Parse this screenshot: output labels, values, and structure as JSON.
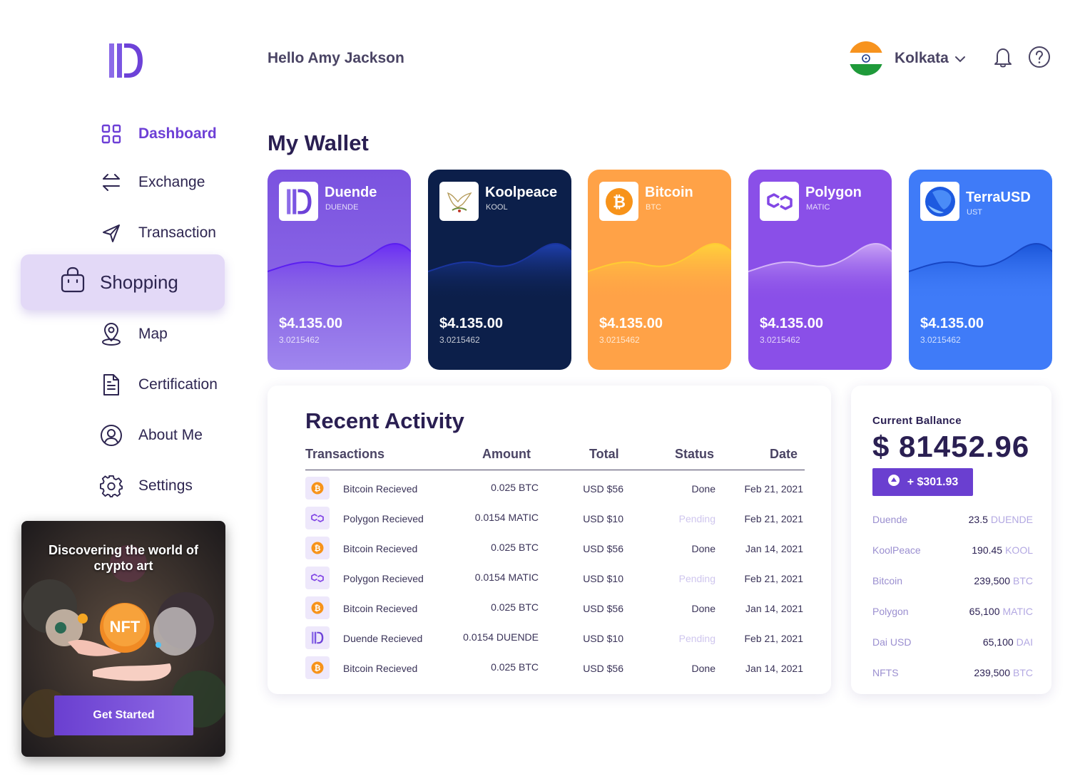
{
  "header": {
    "greeting": "Hello Amy Jackson",
    "location": "Kolkata",
    "icons": [
      "india-flag-icon",
      "chevron-down-icon",
      "bell-icon",
      "help-icon"
    ]
  },
  "sidebar": {
    "items": [
      {
        "label": "Dashboard",
        "icon": "dashboard-icon",
        "active": true
      },
      {
        "label": "Exchange",
        "icon": "exchange-icon"
      },
      {
        "label": "Transaction",
        "icon": "send-icon"
      },
      {
        "label": "Shopping",
        "icon": "shopping-bag-icon",
        "highlighted": true
      },
      {
        "label": "Map",
        "icon": "map-pin-icon"
      },
      {
        "label": "Certification",
        "icon": "document-icon"
      },
      {
        "label": "About Me",
        "icon": "user-icon"
      },
      {
        "label": "Settings",
        "icon": "gear-icon"
      }
    ],
    "promo": {
      "title": "Discovering the  world of crypto art",
      "badge": "NFT",
      "button": "Get Started"
    }
  },
  "wallet": {
    "title": "My Wallet",
    "cards": [
      {
        "name": "Duende",
        "symbol": "DUENDE",
        "amount": "$4.135.00",
        "sub": "3.0215462",
        "color": "#7b56e0"
      },
      {
        "name": "Koolpeace",
        "symbol": "KOOL",
        "amount": "$4.135.00",
        "sub": "3.0215462",
        "color": "#0c1f4a"
      },
      {
        "name": "Bitcoin",
        "symbol": "BTC",
        "amount": "$4.135.00",
        "sub": "3.0215462",
        "color": "#ffa247"
      },
      {
        "name": "Polygon",
        "symbol": "MATIC",
        "amount": "$4.135.00",
        "sub": "3.0215462",
        "color": "#8a4fe8"
      },
      {
        "name": "TerraUSD",
        "symbol": "UST",
        "amount": "$4.135.00",
        "sub": "3.0215462",
        "color": "#3f7bf8"
      }
    ]
  },
  "activity": {
    "title": "Recent Activity",
    "columns": [
      "Transactions",
      "Amount",
      "Total",
      "Status",
      "Date"
    ],
    "rows": [
      {
        "icon": "bitcoin-icon",
        "tx": "Bitcoin Recieved",
        "amount": "0.025 BTC",
        "total": "USD $56",
        "status": "Done",
        "date": "Feb 21, 2021"
      },
      {
        "icon": "polygon-icon",
        "tx": "Polygon Recieved",
        "amount": "0.0154 MATIC",
        "total": "USD $10",
        "status": "Pending",
        "date": "Feb 21, 2021"
      },
      {
        "icon": "bitcoin-icon",
        "tx": "Bitcoin Recieved",
        "amount": "0.025 BTC",
        "total": "USD $56",
        "status": "Done",
        "date": "Jan 14, 2021"
      },
      {
        "icon": "polygon-icon",
        "tx": "Polygon Recieved",
        "amount": "0.0154 MATIC",
        "total": "USD $10",
        "status": "Pending",
        "date": "Feb 21, 2021"
      },
      {
        "icon": "bitcoin-icon",
        "tx": "Bitcoin Recieved",
        "amount": "0.025 BTC",
        "total": "USD $56",
        "status": "Done",
        "date": "Jan 14, 2021"
      },
      {
        "icon": "duende-icon",
        "tx": "Duende Recieved",
        "amount": "0.0154 DUENDE",
        "total": "USD $10",
        "status": "Pending",
        "date": "Feb 21, 2021"
      },
      {
        "icon": "bitcoin-icon",
        "tx": "Bitcoin Recieved",
        "amount": "0.025 BTC",
        "total": "USD $56",
        "status": "Done",
        "date": "Jan 14, 2021"
      }
    ]
  },
  "balance": {
    "label": "Current Ballance",
    "value": "$ 81452.96",
    "change": "+ $301.93",
    "items": [
      {
        "name": "Duende",
        "value": "23.5",
        "unit": "DUENDE"
      },
      {
        "name": "KoolPeace",
        "value": "190.45",
        "unit": "KOOL"
      },
      {
        "name": "Bitcoin",
        "value": "239,500",
        "unit": "BTC"
      },
      {
        "name": "Polygon",
        "value": "65,100",
        "unit": "MATIC"
      },
      {
        "name": "Dai USD",
        "value": "65,100",
        "unit": "DAI"
      },
      {
        "name": "NFTS",
        "value": "239,500",
        "unit": "BTC"
      }
    ]
  }
}
